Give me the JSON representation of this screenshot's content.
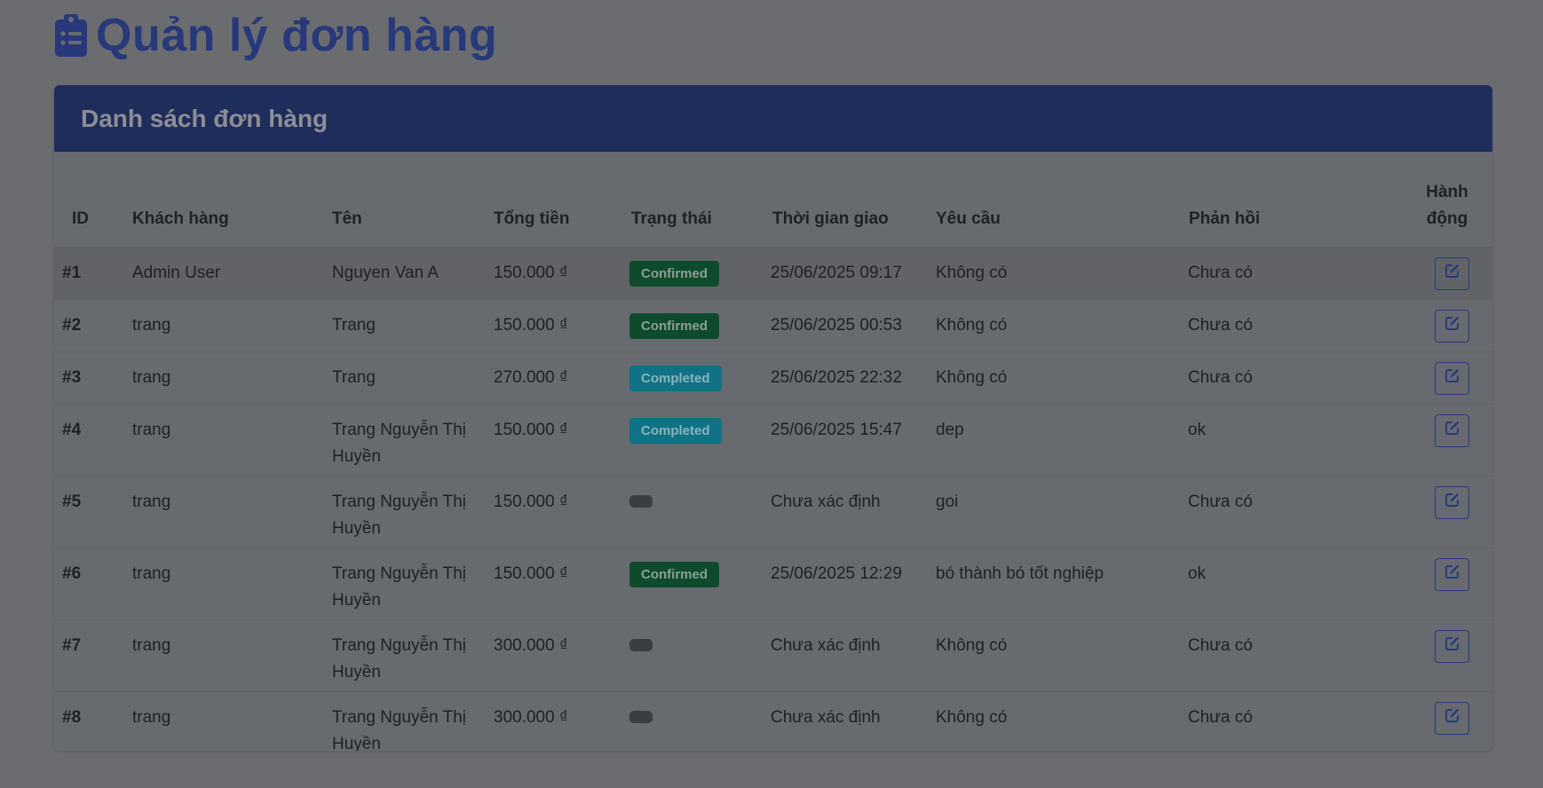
{
  "page": {
    "title": "Quản lý đơn hàng",
    "title_icon": "clipboard-list-icon"
  },
  "card": {
    "title": "Danh sách đơn hàng"
  },
  "table": {
    "headers": {
      "id": "ID",
      "customer": "Khách hàng",
      "name": "Tên",
      "total": "Tổng tiền",
      "status": "Trạng thái",
      "delivery_time": "Thời gian giao",
      "request": "Yêu cầu",
      "feedback": "Phản hồi",
      "action": "Hành động"
    },
    "rows": [
      {
        "id": "#1",
        "customer": "Admin User",
        "name": "Nguyen Van A",
        "total": "150.000 ₫",
        "status": "Confirmed",
        "status_kind": "confirmed",
        "delivery_time": "25/06/2025 09:17",
        "request": "Không có",
        "feedback": "Chưa có",
        "action_icon": "edit-icon"
      },
      {
        "id": "#2",
        "customer": "trang",
        "name": "Trang",
        "total": "150.000 ₫",
        "status": "Confirmed",
        "status_kind": "confirmed",
        "delivery_time": "25/06/2025 00:53",
        "request": "Không có",
        "feedback": "Chưa có",
        "action_icon": "edit-icon"
      },
      {
        "id": "#3",
        "customer": "trang",
        "name": "Trang",
        "total": "270.000 ₫",
        "status": "Completed",
        "status_kind": "completed",
        "delivery_time": "25/06/2025 22:32",
        "request": "Không có",
        "feedback": "Chưa có",
        "action_icon": "edit-icon"
      },
      {
        "id": "#4",
        "customer": "trang",
        "name": "Trang Nguyễn Thị Huyền",
        "total": "150.000 ₫",
        "status": "Completed",
        "status_kind": "completed",
        "delivery_time": "25/06/2025 15:47",
        "request": "dep",
        "feedback": "ok",
        "action_icon": "edit-icon"
      },
      {
        "id": "#5",
        "customer": "trang",
        "name": "Trang Nguyễn Thị Huyền",
        "total": "150.000 ₫",
        "status": "",
        "status_kind": "empty",
        "delivery_time": "Chưa xác định",
        "request": "goi",
        "feedback": "Chưa có",
        "action_icon": "edit-icon"
      },
      {
        "id": "#6",
        "customer": "trang",
        "name": "Trang Nguyễn Thị Huyền",
        "total": "150.000 ₫",
        "status": "Confirmed",
        "status_kind": "confirmed",
        "delivery_time": "25/06/2025 12:29",
        "request": "bó thành bó tốt nghiệp",
        "feedback": "ok",
        "action_icon": "edit-icon"
      },
      {
        "id": "#7",
        "customer": "trang",
        "name": "Trang Nguyễn Thị Huyền",
        "total": "300.000 ₫",
        "status": "",
        "status_kind": "empty",
        "delivery_time": "Chưa xác định",
        "request": "Không có",
        "feedback": "Chưa có",
        "action_icon": "edit-icon"
      },
      {
        "id": "#8",
        "customer": "trang",
        "name": "Trang Nguyễn Thị Huyền",
        "total": "300.000 ₫",
        "status": "",
        "status_kind": "empty",
        "delivery_time": "Chưa xác định",
        "request": "Không có",
        "feedback": "Chưa có",
        "action_icon": "edit-icon"
      }
    ]
  },
  "colors": {
    "accent": "#27397a",
    "confirmed": "#0e4b2c",
    "completed": "#0f7385"
  }
}
